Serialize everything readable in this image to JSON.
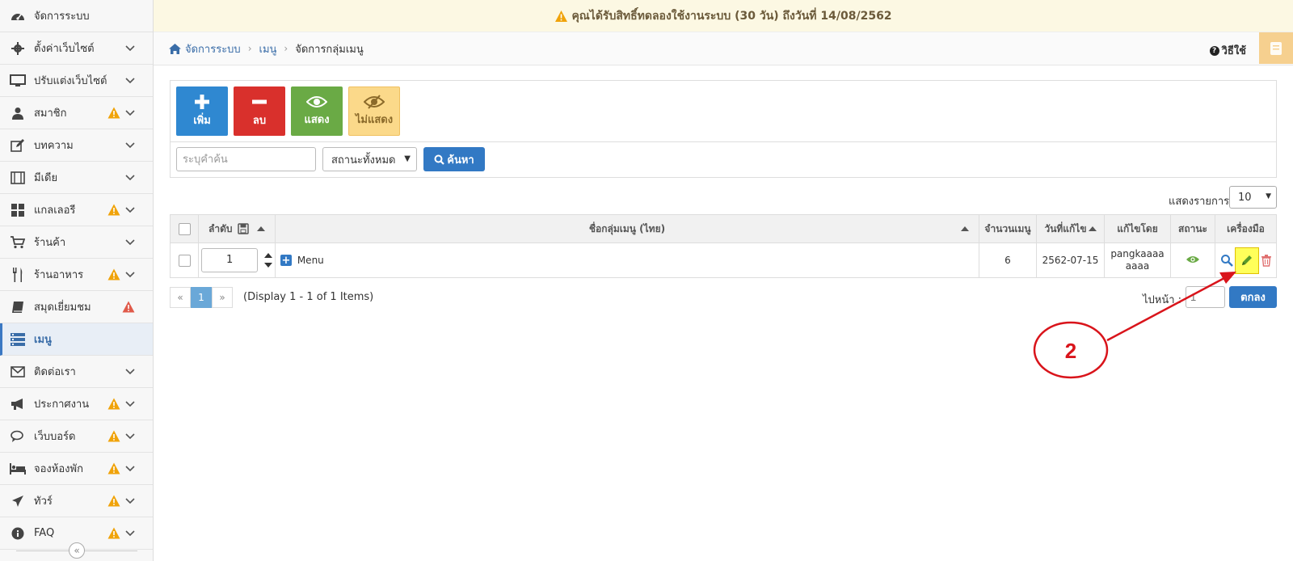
{
  "sidebar": {
    "items": [
      {
        "label": "จัดการระบบ",
        "icon": "dashboard-icon",
        "warn": false,
        "danger": false,
        "chevron": false,
        "active": false
      },
      {
        "label": "ตั้งค่าเว็บไซต์",
        "icon": "gear-icon",
        "warn": false,
        "danger": false,
        "chevron": true,
        "active": false
      },
      {
        "label": "ปรับแต่งเว็บไซต์",
        "icon": "monitor-icon",
        "warn": false,
        "danger": false,
        "chevron": true,
        "active": false
      },
      {
        "label": "สมาชิก",
        "icon": "user-icon",
        "warn": true,
        "danger": false,
        "chevron": true,
        "active": false
      },
      {
        "label": "บทความ",
        "icon": "edit-icon",
        "warn": false,
        "danger": false,
        "chevron": true,
        "active": false
      },
      {
        "label": "มีเดีย",
        "icon": "film-icon",
        "warn": false,
        "danger": false,
        "chevron": true,
        "active": false
      },
      {
        "label": "แกลเลอรี",
        "icon": "grid-icon",
        "warn": true,
        "danger": false,
        "chevron": true,
        "active": false
      },
      {
        "label": "ร้านค้า",
        "icon": "cart-icon",
        "warn": false,
        "danger": false,
        "chevron": true,
        "active": false
      },
      {
        "label": "ร้านอาหาร",
        "icon": "cutlery-icon",
        "warn": true,
        "danger": false,
        "chevron": true,
        "active": false
      },
      {
        "label": "สมุดเยี่ยมชม",
        "icon": "book-icon",
        "warn": false,
        "danger": true,
        "chevron": false,
        "active": false
      },
      {
        "label": "เมนู",
        "icon": "menu-icon",
        "warn": false,
        "danger": false,
        "chevron": false,
        "active": true
      },
      {
        "label": "ติดต่อเรา",
        "icon": "envelope-icon",
        "warn": false,
        "danger": false,
        "chevron": true,
        "active": false
      },
      {
        "label": "ประกาศงาน",
        "icon": "megaphone-icon",
        "warn": true,
        "danger": false,
        "chevron": true,
        "active": false
      },
      {
        "label": "เว็บบอร์ด",
        "icon": "comments-icon",
        "warn": true,
        "danger": false,
        "chevron": true,
        "active": false
      },
      {
        "label": "จองห้องพัก",
        "icon": "bed-icon",
        "warn": true,
        "danger": false,
        "chevron": true,
        "active": false
      },
      {
        "label": "ทัวร์",
        "icon": "plane-icon",
        "warn": true,
        "danger": false,
        "chevron": true,
        "active": false
      },
      {
        "label": "FAQ",
        "icon": "info-icon",
        "warn": true,
        "danger": false,
        "chevron": true,
        "active": false
      }
    ],
    "collapse_label": "«"
  },
  "notice": {
    "text": "คุณได้รับสิทธิ์ทดลองใช้งานระบบ (30 วัน) ถึงวันที่ 14/08/2562"
  },
  "breadcrumb": {
    "home": "จัดการระบบ",
    "level2": "เมนู",
    "current": "จัดการกลุ่มเมนู"
  },
  "help": {
    "label": "วิธีใช้"
  },
  "toolbar": {
    "add": "เพิ่ม",
    "delete": "ลบ",
    "show": "แสดง",
    "hide": "ไม่แสดง"
  },
  "search": {
    "placeholder": "ระบุคำค้น",
    "status_value": "สถานะทั้งหมด",
    "button": "ค้นหา"
  },
  "perpage": {
    "label": "แสดงรายการ",
    "value": "10"
  },
  "table": {
    "headers": {
      "order": "ลำดับ",
      "name": "ชื่อกลุ่มเมนู (ไทย)",
      "count": "จำนวนเมนู",
      "date": "วันที่แก้ไข",
      "editor": "แก้ไขโดย",
      "status": "สถานะ",
      "tools": "เครื่องมือ"
    },
    "rows": [
      {
        "order": "1",
        "name": "Menu",
        "count": "6",
        "date": "2562-07-15",
        "editor": "pangkaaaaaaaa"
      }
    ]
  },
  "pagination": {
    "prev": "«",
    "page": "1",
    "next": "»",
    "info": "(Display 1 - 1 of 1 Items)",
    "goto_label": "ไปหน้า :",
    "goto_value": "1",
    "goto_button": "ตกลง"
  },
  "annotation": {
    "number": "2",
    "color": "#d9141b"
  }
}
